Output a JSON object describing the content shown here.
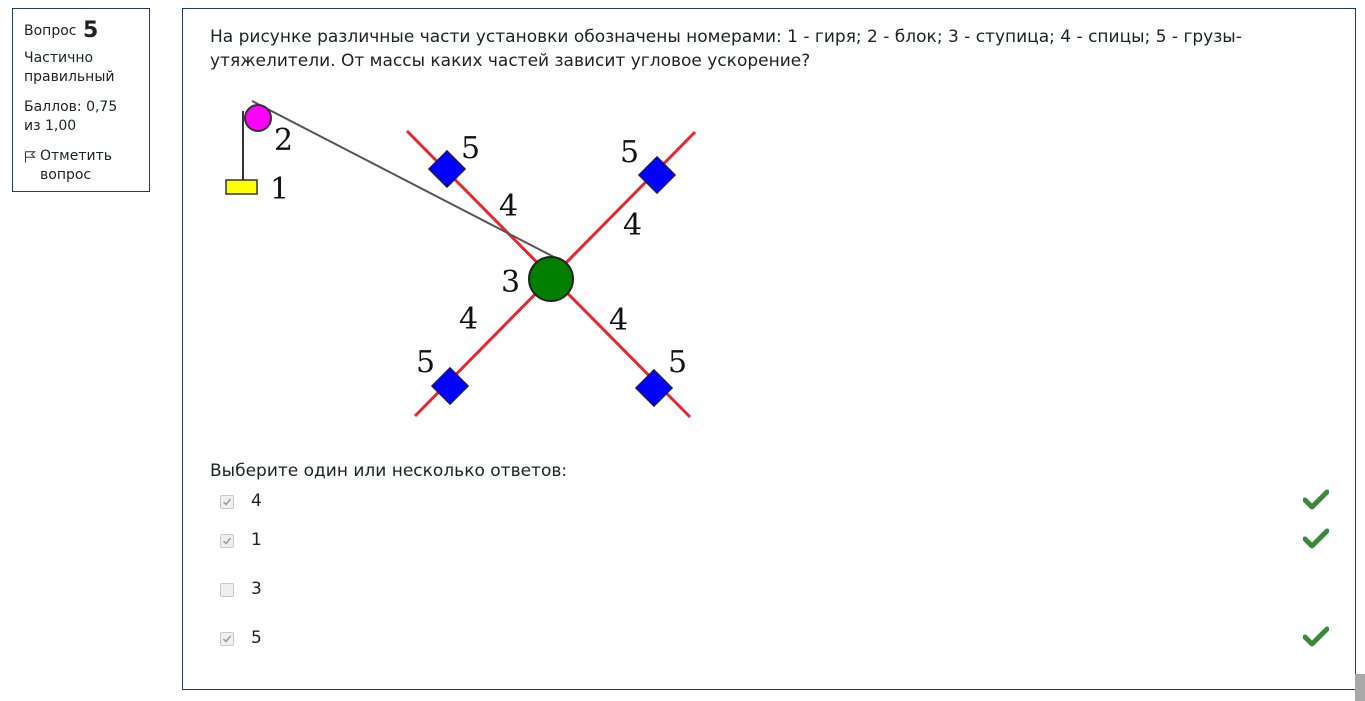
{
  "info": {
    "question_label": "Вопрос",
    "question_number": "5",
    "state": "Частично правильный",
    "grade": "Баллов: 0,75 из 1,00",
    "flag_label": "Отметить вопрос",
    "flag_icon": "flag-icon"
  },
  "question": {
    "text": "На рисунке различные части установки обозначены  номерами: 1 - гиря; 2 - блок; 3 - ступица; 4 - спицы; 5 - грузы-утяжелители. От массы каких частей зависит угловое ускорение?",
    "figure": {
      "labels": [
        "1",
        "2",
        "3",
        "4",
        "4",
        "4",
        "4",
        "5",
        "5",
        "5",
        "5"
      ],
      "colors": {
        "weight": "#ffff00",
        "pulley": "#ff00ff",
        "hub": "#008000",
        "spokes": "#e8262f",
        "weights_5": "#0000ff",
        "string": "#555555"
      }
    }
  },
  "answers": {
    "prompt": "Выберите один или несколько ответов:",
    "options": [
      {
        "label": "4",
        "checked": true,
        "correct_mark": true
      },
      {
        "label": "1",
        "checked": true,
        "correct_mark": true
      },
      {
        "label": "3",
        "checked": false,
        "correct_mark": false
      },
      {
        "label": "5",
        "checked": true,
        "correct_mark": true
      }
    ],
    "check_color": "#3b8a3b"
  }
}
